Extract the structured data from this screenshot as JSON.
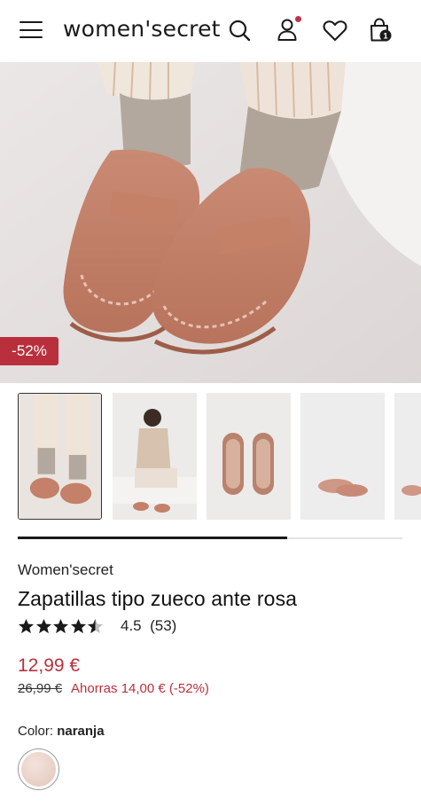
{
  "header": {
    "logo": "women'secret",
    "icons": [
      "menu-icon",
      "search-icon",
      "user-icon",
      "heart-icon",
      "bag-icon"
    ],
    "cart_count": "1"
  },
  "gallery": {
    "discount_badge": "-52%",
    "thumbnails": [
      "thumbnail-1",
      "thumbnail-2",
      "thumbnail-3",
      "thumbnail-4",
      "thumbnail-5"
    ],
    "scroll_progress": 0.7
  },
  "product": {
    "brand": "Women'secret",
    "title": "Zapatillas tipo zueco ante rosa",
    "rating_stars": 4.5,
    "rating_text": "4.5",
    "reviews": "(53)",
    "price": "12,99 €",
    "old_price": "26,99 €",
    "savings": "Ahorras 14,00 € (-52%)",
    "color_label": "Color:",
    "color_value": "naranja"
  },
  "colors": {
    "accent": "#b9303c",
    "text": "#1a1a1a",
    "swatch": "#e8cfc4"
  }
}
